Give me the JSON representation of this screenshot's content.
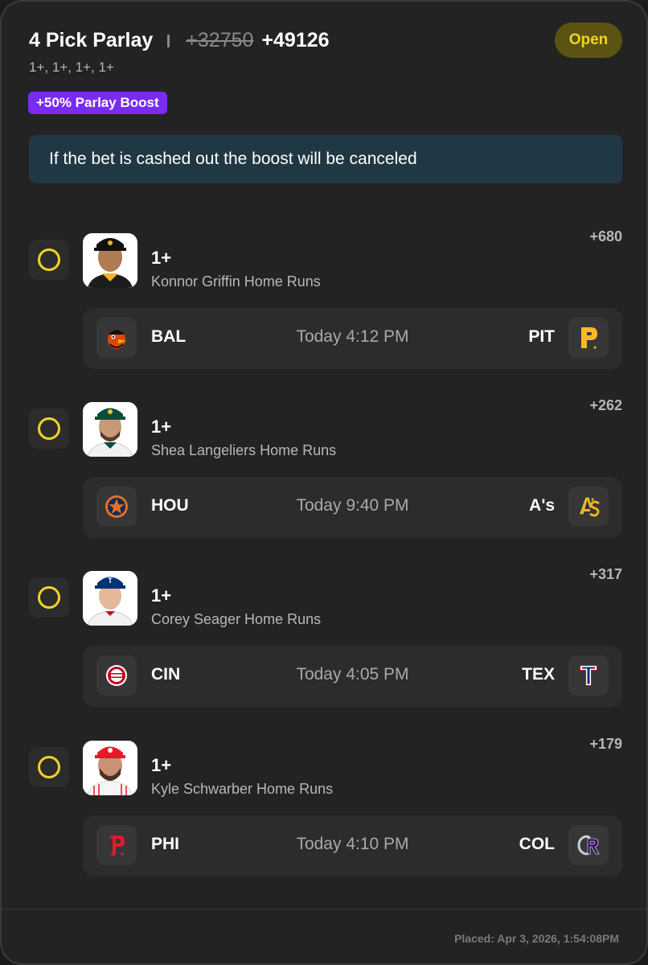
{
  "header": {
    "title": "4 Pick Parlay",
    "old_odds": "+32750",
    "new_odds": "+49126",
    "status": "Open",
    "lines_summary": "1+, 1+, 1+, 1+",
    "boost": "+50% Parlay Boost",
    "notice": "If the bet is cashed out the boost will be canceled"
  },
  "legs": [
    {
      "line": "1+",
      "market": "Konnor Griffin Home Runs",
      "odds": "+680",
      "away": "BAL",
      "time": "Today 4:12 PM",
      "home": "PIT",
      "away_logo": "orioles-bird-icon",
      "home_logo": "pirates-p-icon"
    },
    {
      "line": "1+",
      "market": "Shea Langeliers Home Runs",
      "odds": "+262",
      "away": "HOU",
      "time": "Today 9:40 PM",
      "home": "A's",
      "away_logo": "astros-star-icon",
      "home_logo": "athletics-logo-icon"
    },
    {
      "line": "1+",
      "market": "Corey Seager Home Runs",
      "odds": "+317",
      "away": "CIN",
      "time": "Today 4:05 PM",
      "home": "TEX",
      "away_logo": "reds-logo-icon",
      "home_logo": "rangers-t-icon"
    },
    {
      "line": "1+",
      "market": "Kyle Schwarber Home Runs",
      "odds": "+179",
      "away": "PHI",
      "time": "Today 4:10 PM",
      "home": "COL",
      "away_logo": "phillies-p-icon",
      "home_logo": "rockies-cr-icon"
    }
  ],
  "footer": {
    "placed": "Placed: Apr 3, 2026, 1:54:08PM"
  },
  "colors": {
    "accent_yellow": "#f3d325",
    "boost_purple": "#7a2bf0",
    "notice_bg": "#203844"
  }
}
